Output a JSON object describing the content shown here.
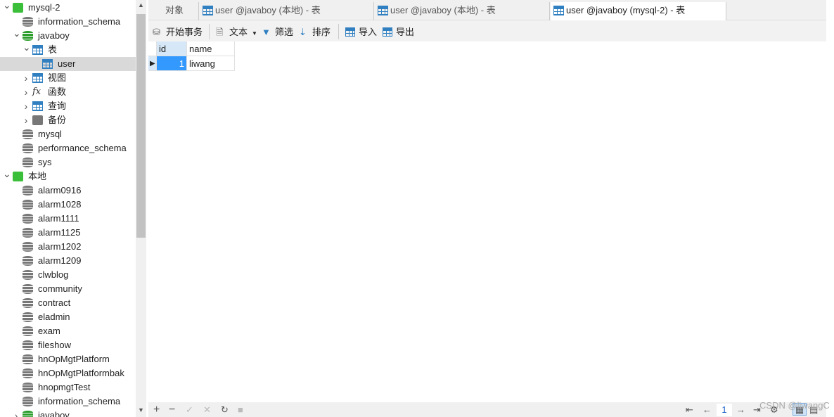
{
  "sidebar": {
    "items": [
      {
        "label": "mysql-2",
        "level": 0,
        "icon": "connection-icon",
        "expanded": true
      },
      {
        "label": "information_schema",
        "level": 1,
        "icon": "database-icon"
      },
      {
        "label": "javaboy",
        "level": 1,
        "icon": "database-open-icon",
        "expanded": true
      },
      {
        "label": "表",
        "level": 2,
        "icon": "table-folder-icon",
        "expanded": true
      },
      {
        "label": "user",
        "level": 3,
        "icon": "table-icon",
        "selected": true
      },
      {
        "label": "视图",
        "level": 2,
        "icon": "view-icon",
        "collapsed": true
      },
      {
        "label": "函数",
        "level": 2,
        "icon": "function-icon",
        "collapsed": true
      },
      {
        "label": "查询",
        "level": 2,
        "icon": "query-icon",
        "collapsed": true
      },
      {
        "label": "备份",
        "level": 2,
        "icon": "backup-icon",
        "collapsed": true
      },
      {
        "label": "mysql",
        "level": 1,
        "icon": "database-icon"
      },
      {
        "label": "performance_schema",
        "level": 1,
        "icon": "database-icon"
      },
      {
        "label": "sys",
        "level": 1,
        "icon": "database-icon"
      },
      {
        "label": "本地",
        "level": 0,
        "icon": "connection-icon",
        "expanded": true
      },
      {
        "label": "alarm0916",
        "level": 1,
        "icon": "database-icon"
      },
      {
        "label": "alarm1028",
        "level": 1,
        "icon": "database-icon"
      },
      {
        "label": "alarm1111",
        "level": 1,
        "icon": "database-icon"
      },
      {
        "label": "alarm1125",
        "level": 1,
        "icon": "database-icon"
      },
      {
        "label": "alarm1202",
        "level": 1,
        "icon": "database-icon"
      },
      {
        "label": "alarm1209",
        "level": 1,
        "icon": "database-icon"
      },
      {
        "label": "clwblog",
        "level": 1,
        "icon": "database-icon"
      },
      {
        "label": "community",
        "level": 1,
        "icon": "database-icon"
      },
      {
        "label": "contract",
        "level": 1,
        "icon": "database-icon"
      },
      {
        "label": "eladmin",
        "level": 1,
        "icon": "database-icon"
      },
      {
        "label": "exam",
        "level": 1,
        "icon": "database-icon"
      },
      {
        "label": "fileshow",
        "level": 1,
        "icon": "database-icon"
      },
      {
        "label": "hnOpMgtPlatform",
        "level": 1,
        "icon": "database-icon"
      },
      {
        "label": "hnOpMgtPlatformbak",
        "level": 1,
        "icon": "database-icon"
      },
      {
        "label": "hnopmgtTest",
        "level": 1,
        "icon": "database-icon"
      },
      {
        "label": "information_schema",
        "level": 1,
        "icon": "database-icon"
      },
      {
        "label": "javaboy",
        "level": 1,
        "icon": "database-open-icon",
        "collapsed": true
      }
    ]
  },
  "tabs": [
    {
      "label": "对象"
    },
    {
      "label": "user @javaboy (本地) - 表",
      "icon": "table-edit-icon"
    },
    {
      "label": "user @javaboy (本地) - 表",
      "icon": "table-icon"
    },
    {
      "label": "user @javaboy (mysql-2) - 表",
      "icon": "table-icon",
      "active": true
    }
  ],
  "toolbar": {
    "begin_transaction": "开始事务",
    "text": "文本",
    "filter": "筛选",
    "sort": "排序",
    "import": "导入",
    "export": "导出"
  },
  "grid": {
    "columns": [
      "id",
      "name"
    ],
    "rows": [
      [
        "1",
        "liwang"
      ]
    ]
  },
  "pager": {
    "page": "1"
  },
  "watermark": "CSDN @liwangC"
}
